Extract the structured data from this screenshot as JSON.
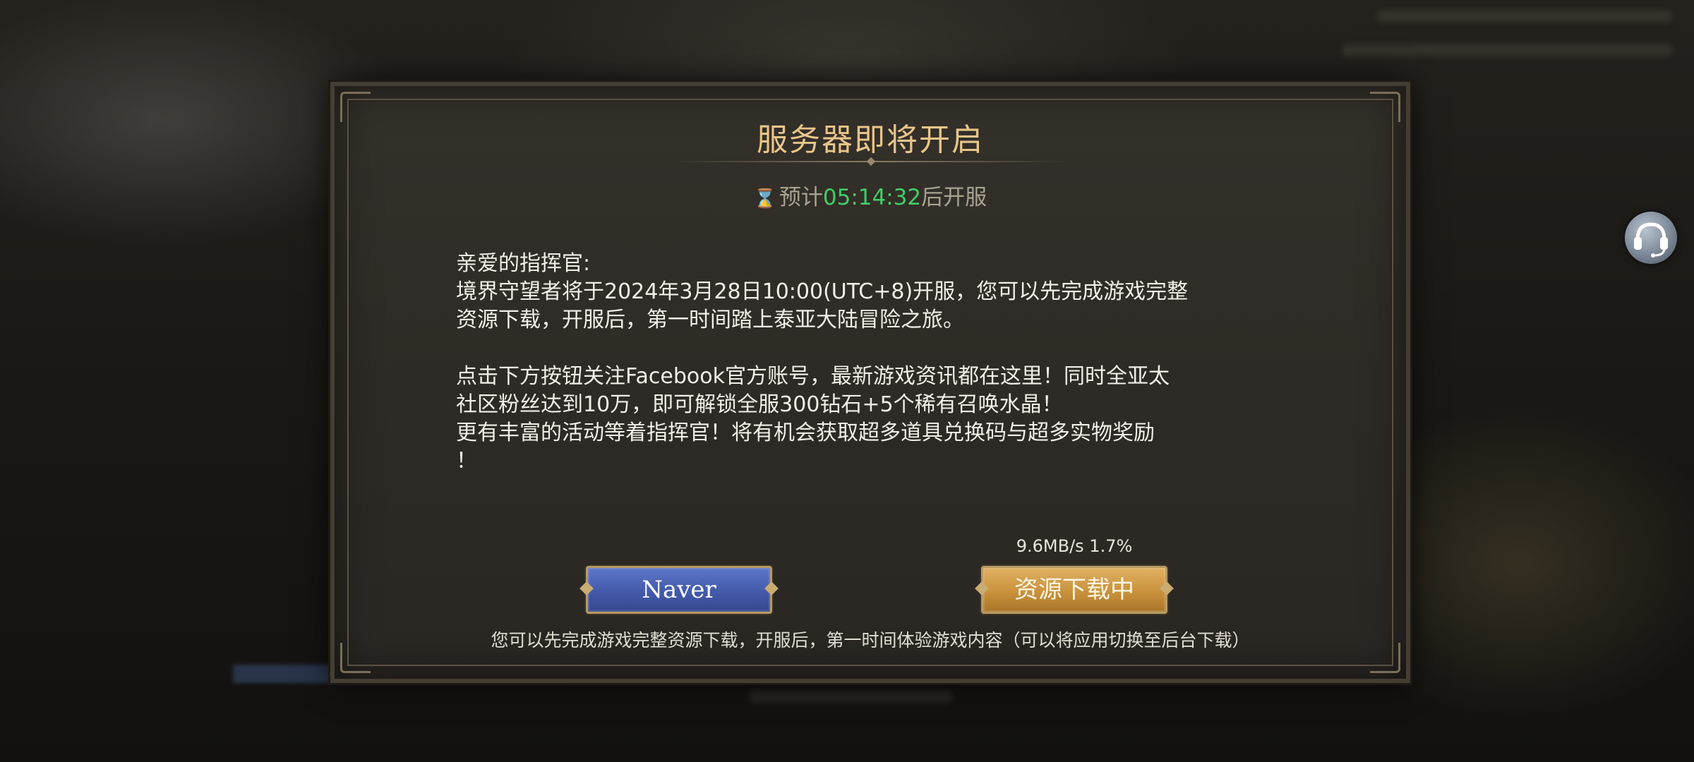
{
  "dialog": {
    "title": "服务器即将开启",
    "countdown_prefix": "预计",
    "countdown_time": "05:14:32",
    "countdown_suffix": "后开服",
    "greeting": "亲爱的指挥官:",
    "para1_line1": "境界守望者将于2024年3月28日10:00(UTC+8)开服，您可以先完成游戏完整",
    "para1_line2": "资源下载，开服后，第一时间踏上泰亚大陆冒险之旅。",
    "para2_line1": "点击下方按钮关注Facebook官方账号，最新游戏资讯都在这里！同时全亚太",
    "para2_line2": "社区粉丝达到10万，即可解锁全服300钻石+5个稀有召唤水晶！",
    "para2_line3": "更有丰富的活动等着指挥官！将有机会获取超多道具兑换码与超多实物奖励",
    "para2_line4": "！"
  },
  "download": {
    "speed_text": "9.6MB/s 1.7%",
    "button_label": "资源下载中",
    "progress_percent": 1.7
  },
  "buttons": {
    "naver_label": "Naver"
  },
  "footer": {
    "note": "您可以先完成游戏完整资源下载，开服后，第一时间体验游戏内容（可以将应用切换至后台下载）"
  },
  "icons": {
    "hourglass": "hourglass-icon",
    "support": "headset-icon"
  },
  "colors": {
    "title": "#e8c58a",
    "countdown_time": "#3fcf66",
    "naver_button": "#4359aa",
    "download_button": "#c9923d"
  }
}
